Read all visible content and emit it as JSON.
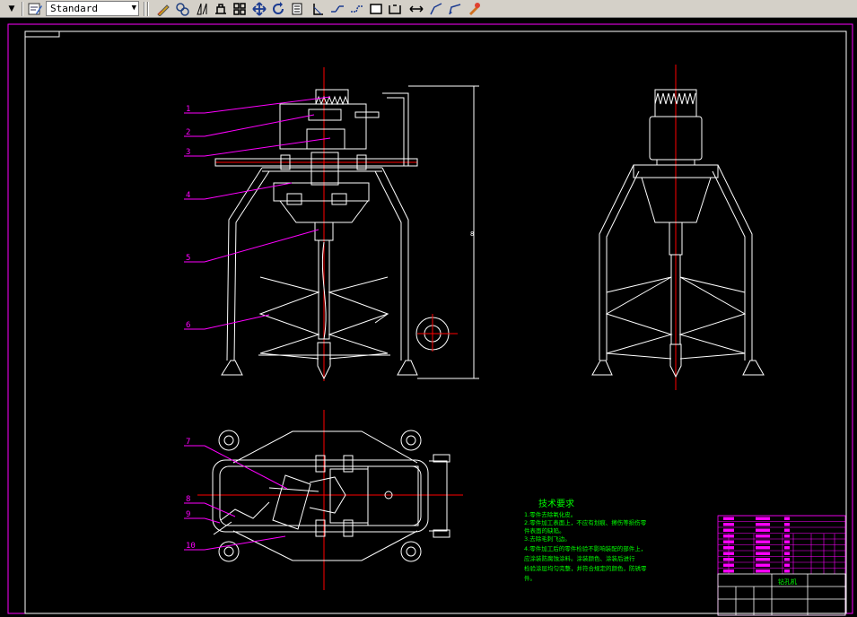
{
  "toolbar": {
    "text_style_value": "Standard",
    "buttons": [
      "dimension-linear-icon",
      "dimension-aligned-icon",
      "dimension-arc-icon",
      "dimension-ordinate-icon",
      "dimension-grid-icon",
      "move-icon",
      "rotate-icon",
      "tolerance-icon",
      "dimension-angular-icon",
      "dimension-break-icon",
      "dimension-jog-icon",
      "dimension-box-icon",
      "dimension-baseline-icon",
      "dimension-continue-icon",
      "leader-icon",
      "quick-leader-icon",
      "dimension-edit-icon"
    ]
  },
  "drawing": {
    "leader_labels": [
      "1",
      "2",
      "3",
      "4",
      "5",
      "6",
      "7",
      "8",
      "9",
      "10"
    ],
    "dim_height": "8",
    "tech_title": "技术要求",
    "tech_lines": [
      "1.零件去除氧化皮。",
      "2.零件加工表面上，不应有划痕、擦伤等损伤零",
      "件表面的缺陷。",
      "3.去除毛刺飞边。",
      "4.零件加工后的零件检验不影响装配的部件上，",
      "应涂装防腐蚀涂料。涂装颜色、涂装后进行",
      "检验涂层均匀完整，并符合规定的颜色，防锈零",
      "件。"
    ],
    "title_block_name": "钻孔机"
  },
  "colors": {
    "drawing_white": "#ffffff",
    "leader_magenta": "#ff00ff",
    "center_red": "#ff0000",
    "text_green": "#00ff00",
    "frame_purple": "#ff00ff",
    "gray_border": "#7f7f7f"
  }
}
